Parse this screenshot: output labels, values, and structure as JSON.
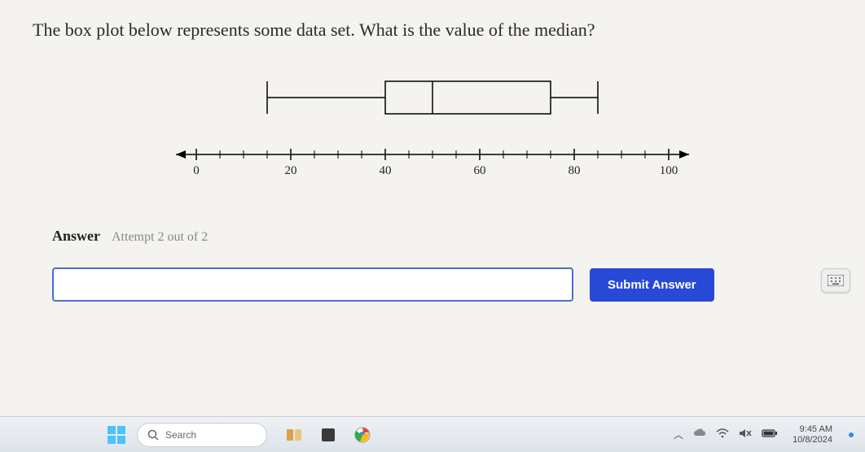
{
  "question": "The box plot below represents some data set. What is the value of the median?",
  "chart_data": {
    "type": "boxplot",
    "min": 15,
    "q1": 40,
    "median": 50,
    "q3": 75,
    "max": 85,
    "axis": {
      "min": 0,
      "max": 100,
      "step": 5,
      "labels_step": 20
    },
    "ticks": [
      "0",
      "20",
      "40",
      "60",
      "80",
      "100"
    ]
  },
  "answer": {
    "label": "Answer",
    "attempt": "Attempt 2 out of 2",
    "value": "",
    "placeholder": ""
  },
  "buttons": {
    "submit": "Submit Answer"
  },
  "icons": {
    "keypad": "keypad-icon",
    "search": "search-icon"
  },
  "taskbar": {
    "search_placeholder": "Search",
    "time": "9:45 AM",
    "date": "10/8/2024"
  }
}
